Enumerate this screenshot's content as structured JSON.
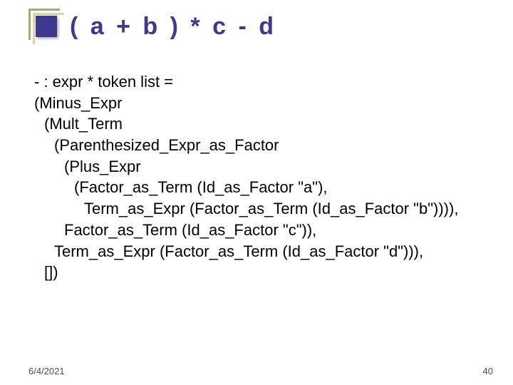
{
  "title": "( a + b ) * c - d",
  "body": {
    "lines": [
      {
        "cls": "l1",
        "text": "- : expr * token list ="
      },
      {
        "cls": "l2",
        "text": "(Minus_Expr"
      },
      {
        "cls": "l3",
        "text": "(Mult_Term"
      },
      {
        "cls": "l4",
        "text": "(Parenthesized_Expr_as_Factor"
      },
      {
        "cls": "l5",
        "text": "(Plus_Expr"
      },
      {
        "cls": "l6",
        "text": "(Factor_as_Term (Id_as_Factor \"a\"),"
      },
      {
        "cls": "l7",
        "text": "Term_as_Expr (Factor_as_Term (Id_as_Factor \"b\")))),"
      },
      {
        "cls": "l5",
        "text": "Factor_as_Term (Id_as_Factor \"c\")),"
      },
      {
        "cls": "l4",
        "text": "Term_as_Expr (Factor_as_Term (Id_as_Factor \"d\"))),"
      },
      {
        "cls": "l3",
        "text": "[])"
      }
    ]
  },
  "footer": {
    "date": "6/4/2021",
    "page": "40"
  }
}
